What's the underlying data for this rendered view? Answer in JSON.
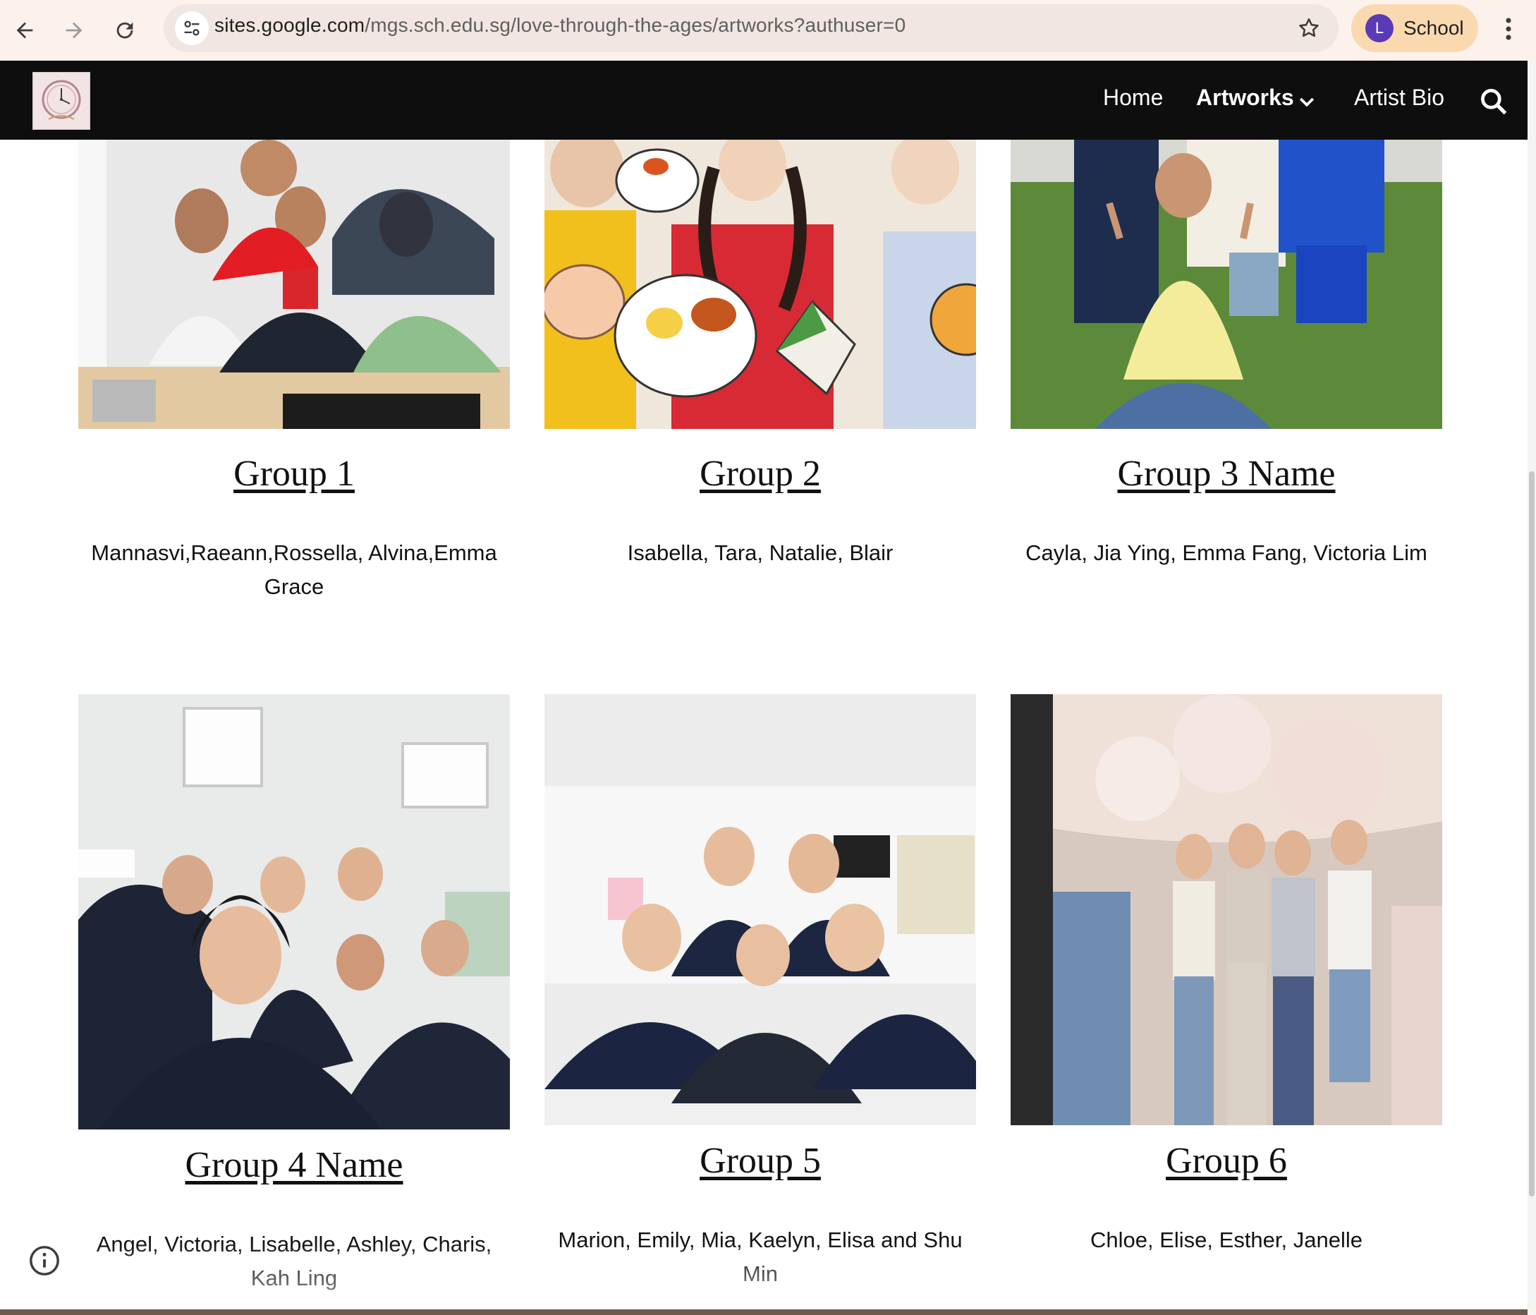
{
  "browser": {
    "url_host": "sites.google.com",
    "url_path": "/mgs.sch.edu.sg/love-through-the-ages/artworks?authuser=0",
    "profile_initial": "L",
    "profile_label": "School"
  },
  "site": {
    "nav": {
      "home": "Home",
      "artworks": "Artworks",
      "artist_bio": "Artist Bio"
    }
  },
  "groups": [
    {
      "title": "Group 1",
      "members": "Mannasvi,Raeann,Rossella, Alvina,Emma Grace"
    },
    {
      "title": "Group 2 ",
      "members": "Isabella, Tara, Natalie, Blair"
    },
    {
      "title": "Group 3 Name",
      "members": "Cayla, Jia Ying, Emma Fang, Victoria Lim"
    },
    {
      "title": "Group 4 Name",
      "members": "Angel, Victoria, Lisabelle, Ashley, Charis, Kah Ling"
    },
    {
      "title": "Group 5",
      "members": "Marion, Emily, Mia, Kaelyn, Elisa and Shu Min"
    },
    {
      "title": "Group 6",
      "members": "Chloe, Elise, Esther, Janelle"
    }
  ],
  "colors": {
    "header_bg": "#0e0e0e",
    "chrome_bg": "#fdf1ec",
    "profile_chip": "#fbd9b0",
    "avatar": "#5b3ab6"
  },
  "icons": [
    "back-icon",
    "forward-icon",
    "reload-icon",
    "site-info-icon",
    "bookmark-star-icon",
    "more-icon",
    "chevron-down-icon",
    "search-icon",
    "info-icon"
  ]
}
